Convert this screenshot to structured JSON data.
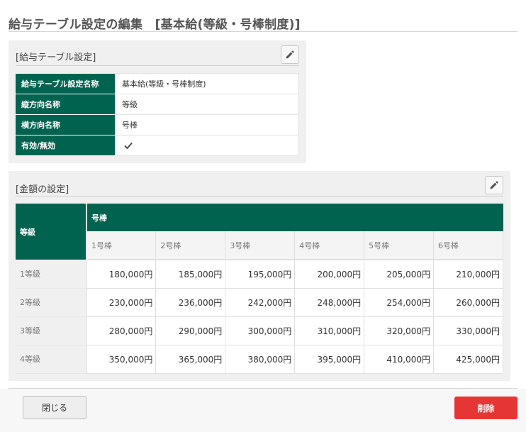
{
  "page": {
    "title": "給与テーブル設定の編集　[基本給(等級・号棒制度)]"
  },
  "settings_panel": {
    "title": "[給与テーブル設定]",
    "rows": [
      {
        "label": "給与テーブル設定名称",
        "value": "基本給(等級・号棒制度)"
      },
      {
        "label": "縦方向名称",
        "value": "等級"
      },
      {
        "label": "横方向名称",
        "value": "号棒"
      },
      {
        "label": "有効/無効",
        "checked": true
      }
    ]
  },
  "amount_panel": {
    "title": "[金額の設定]",
    "row_header": "等級",
    "column_group_header": "号棒",
    "columns": [
      "1号棒",
      "2号棒",
      "3号棒",
      "4号棒",
      "5号棒",
      "6号棒"
    ],
    "rows": [
      {
        "label": "1等級",
        "values": [
          "180,000円",
          "185,000円",
          "195,000円",
          "200,000円",
          "205,000円",
          "210,000円"
        ]
      },
      {
        "label": "2等級",
        "values": [
          "230,000円",
          "236,000円",
          "242,000円",
          "248,000円",
          "254,000円",
          "260,000円"
        ]
      },
      {
        "label": "3等級",
        "values": [
          "280,000円",
          "290,000円",
          "300,000円",
          "310,000円",
          "320,000円",
          "330,000円"
        ]
      },
      {
        "label": "4等級",
        "values": [
          "350,000円",
          "365,000円",
          "380,000円",
          "395,000円",
          "410,000円",
          "425,000円"
        ]
      }
    ]
  },
  "footer": {
    "close_label": "閉じる",
    "delete_label": "削除"
  },
  "colors": {
    "header_green": "#00634f",
    "delete_red": "#e53535"
  },
  "icons": {
    "edit": "pencil-icon",
    "checkbox": "check-icon"
  }
}
